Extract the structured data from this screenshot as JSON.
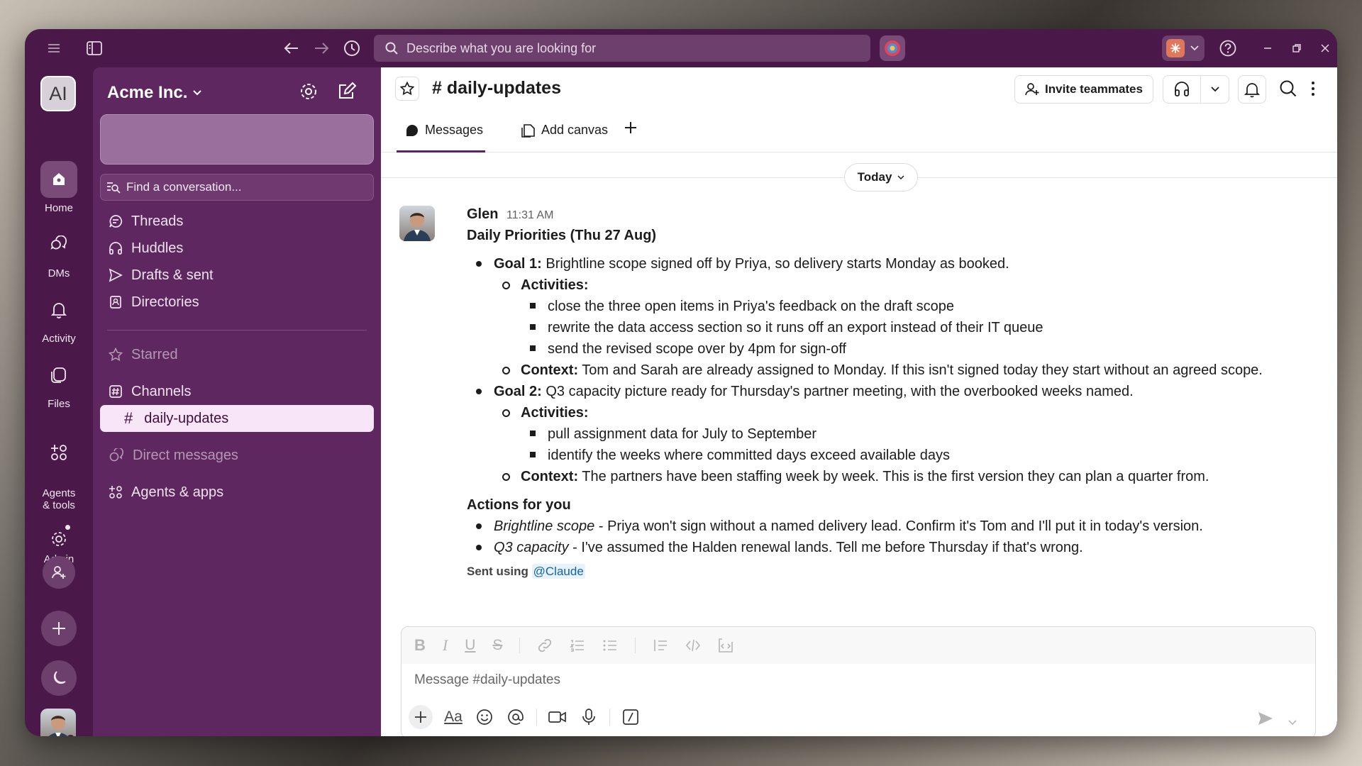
{
  "search": {
    "placeholder": "Describe what you are looking for"
  },
  "rail": {
    "workspace_initials": "AI",
    "items": [
      {
        "label": "Home"
      },
      {
        "label": "DMs"
      },
      {
        "label": "Activity"
      },
      {
        "label": "Files"
      },
      {
        "label": "Agents\n& tools"
      },
      {
        "label": "Admin"
      }
    ]
  },
  "sidebar": {
    "workspace": "Acme Inc.",
    "find": "Find a conversation...",
    "nav": [
      {
        "label": "Threads"
      },
      {
        "label": "Huddles"
      },
      {
        "label": "Drafts & sent"
      },
      {
        "label": "Directories"
      }
    ],
    "starred": "Starred",
    "channels": "Channels",
    "channel_item": "daily-updates",
    "direct_messages": "Direct messages",
    "agents": "Agents & apps"
  },
  "channel": {
    "title": "# daily-updates",
    "invite": "Invite teammates",
    "tabs": [
      {
        "label": "Messages"
      },
      {
        "label": "Add canvas"
      }
    ]
  },
  "divider": "Today",
  "message": {
    "author": "Glen",
    "time": "11:31 AM",
    "title": "Daily Priorities (Thu 27 Aug)",
    "goal1_label": "Goal 1:",
    "goal1_text": " Brightline scope signed off by Priya, so delivery starts Monday as booked.",
    "activities_label": "Activities:",
    "goal1_acts": [
      "close the three open items in Priya's feedback on the draft scope",
      "rewrite the data access section so it runs off an export instead of their IT queue",
      "send the revised scope over by 4pm for sign-off"
    ],
    "context_label": "Context:",
    "goal1_context": " Tom and Sarah are already assigned to Monday. If this isn't signed today they start without an agreed scope.",
    "goal2_label": "Goal 2:",
    "goal2_text": " Q3 capacity picture ready for Thursday's partner meeting, with the overbooked weeks named.",
    "goal2_acts": [
      "pull assignment data for July to September",
      "identify the weeks where committed days exceed available days"
    ],
    "goal2_context": " The partners have been staffing week by week. This is the first version they can plan a quarter from.",
    "actions_heading": "Actions for you",
    "action1_em": "Brightline scope",
    "action1_text": " - Priya won't sign without a named delivery lead. Confirm it's Tom and I'll put it in today's version.",
    "action2_em": "Q3 capacity",
    "action2_text": " - I've assumed the Halden renewal lands. Tell me before Thursday if that's wrong.",
    "sent_using": "Sent using",
    "sent_mention": "@Claude"
  },
  "composer": {
    "placeholder": "Message #daily-updates"
  },
  "colors": {
    "aubergine": "#4a1949",
    "sidebar": "#5f2760",
    "active": "#f9e5f8",
    "link": "#1264a3"
  }
}
